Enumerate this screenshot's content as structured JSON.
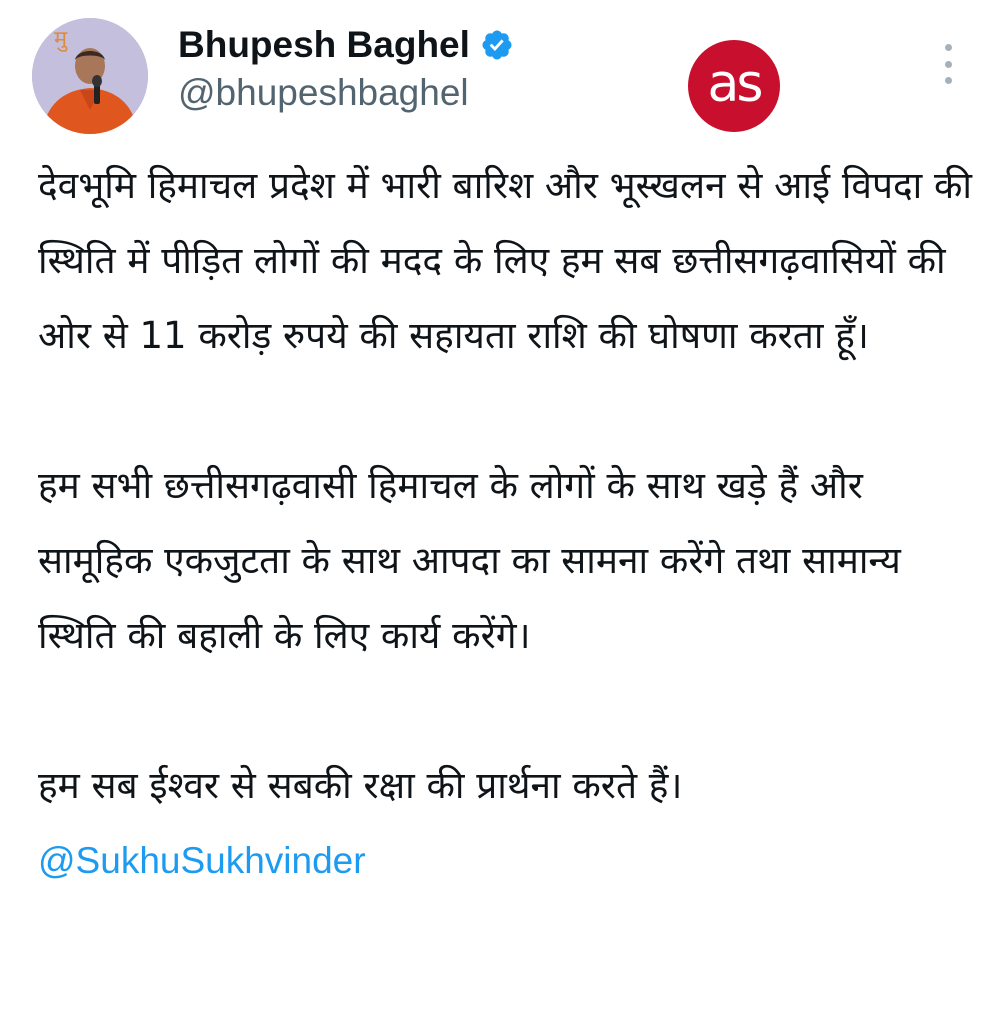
{
  "author": {
    "display_name": "Bhupesh Baghel",
    "handle": "@bhupeshbaghel",
    "verified": true,
    "avatar_icon": "profile-photo"
  },
  "watermark": {
    "text": "as",
    "color": "#c8102e"
  },
  "menu": {
    "icon": "more-options-icon"
  },
  "tweet": {
    "paragraph_1": "देवभूमि हिमाचल प्रदेश में भारी बारिश और भूस्खलन से आई विपदा की स्थिति में पीड़ित लोगों की मदद के लिए हम सब छत्तीसगढ़वासियों की ओर से 11 करोड़ रुपये की सहायता राशि की घोषणा करता हूँ।",
    "paragraph_2": "हम सभी छत्तीसगढ़वासी हिमाचल के लोगों के साथ खड़े हैं और सामूहिक एकजुटता के साथ आपदा का सामना करेंगे तथा सामान्य स्थिति की बहाली के लिए कार्य करेंगे।",
    "paragraph_3": "हम सब ईश्वर से सबकी रक्षा की प्रार्थना करते हैं।",
    "mention": "@SukhuSukhvinder"
  },
  "colors": {
    "link": "#1d9bf0",
    "secondary_text": "#536471",
    "verified_badge": "#1d9bf0"
  }
}
